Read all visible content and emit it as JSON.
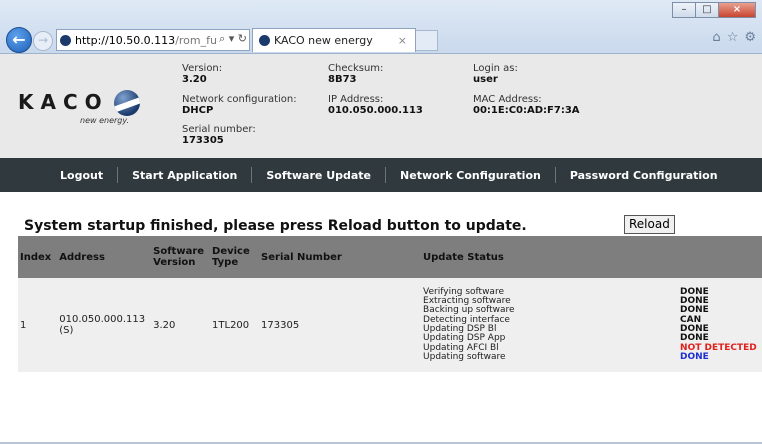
{
  "browser": {
    "address_host": "http://10.50.0.113",
    "address_path": "/rom_fup.cgi",
    "address_tools": "⌕ ▾ ↻",
    "tab_title": "KACO new energy",
    "tab_close": "×",
    "win_min": "–",
    "win_max": "□",
    "win_close": "×",
    "icons": [
      "home-icon",
      "favorites-star-icon",
      "settings-gear-icon"
    ]
  },
  "logo": {
    "word": "KACO",
    "tagline": "new energy."
  },
  "header": {
    "version_label": "Version:",
    "version": "3.20",
    "network_label": "Network configuration:",
    "network": "DHCP",
    "serial_label": "Serial number:",
    "serial": "173305",
    "checksum_label": "Checksum:",
    "checksum": "8B73",
    "ip_label": "IP Address:",
    "ip": "010.050.000.113",
    "login_label": "Login as:",
    "login": "user",
    "mac_label": "MAC Address:",
    "mac": "00:1E:C0:AD:F7:3A"
  },
  "menu": [
    "Logout",
    "Start Application",
    "Software Update",
    "Network Configuration",
    "Password Configuration"
  ],
  "main": {
    "message": "System startup finished, please press Reload button to update.",
    "reload_label": "Reload"
  },
  "table": {
    "headers": {
      "index": "Index",
      "address": "Address",
      "sw_version_1": "Software",
      "sw_version_2": "Version",
      "device_type_1": "Device",
      "device_type_2": "Type",
      "serial": "Serial Number",
      "status": "Update Status"
    },
    "row": {
      "index": "1",
      "address": "010.050.000.113 (S)",
      "sw_version": "3.20",
      "device_type": "1TL200",
      "serial": "173305"
    },
    "steps": [
      {
        "name": "Verifying software",
        "result": "DONE",
        "color": "#111111"
      },
      {
        "name": "Extracting software",
        "result": "DONE",
        "color": "#111111"
      },
      {
        "name": "Backing up software",
        "result": "DONE",
        "color": "#111111"
      },
      {
        "name": "Detecting interface",
        "result": "CAN",
        "color": "#111111"
      },
      {
        "name": "Updating DSP Bl",
        "result": "DONE",
        "color": "#111111"
      },
      {
        "name": "Updating DSP App",
        "result": "DONE",
        "color": "#111111"
      },
      {
        "name": "Updating AFCI Bl",
        "result": "NOT DETECTED",
        "color": "#e0201b"
      },
      {
        "name": "Updating software",
        "result": "DONE",
        "color": "#1d2fd0"
      }
    ]
  }
}
